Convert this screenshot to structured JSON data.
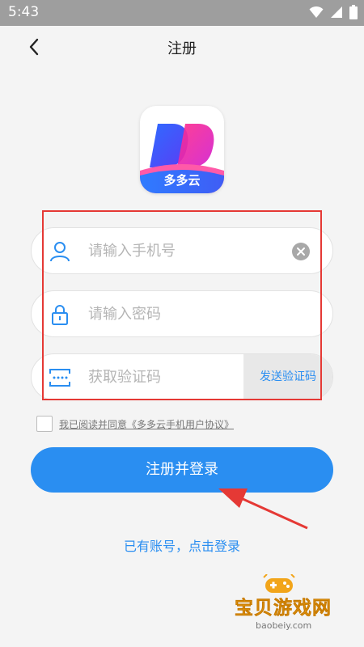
{
  "status_bar": {
    "time": "5:43",
    "icons": [
      "wifi-icon",
      "signal-icon",
      "battery-icon"
    ]
  },
  "header": {
    "title": "注册",
    "back_icon": "chevron-left-icon"
  },
  "logo": {
    "brand_text": "多多云"
  },
  "form": {
    "phone": {
      "placeholder": "请输入手机号",
      "value": "",
      "icon": "user-icon"
    },
    "password": {
      "placeholder": "请输入密码",
      "value": "",
      "icon": "lock-icon"
    },
    "code": {
      "placeholder": "获取验证码",
      "value": "",
      "icon": "verification-code-icon",
      "send_label": "发送验证码"
    }
  },
  "agreement": {
    "checked": false,
    "text": "我已阅读并同意《多多云手机用户协议》"
  },
  "submit_label": "注册并登录",
  "login_link": "已有账号，点击登录",
  "watermark": {
    "cn": "宝贝游戏网",
    "en": "baobeiy.com"
  },
  "colors": {
    "primary": "#2a8ef1",
    "annotation_red": "#e53935",
    "background": "#f4f4f4"
  }
}
